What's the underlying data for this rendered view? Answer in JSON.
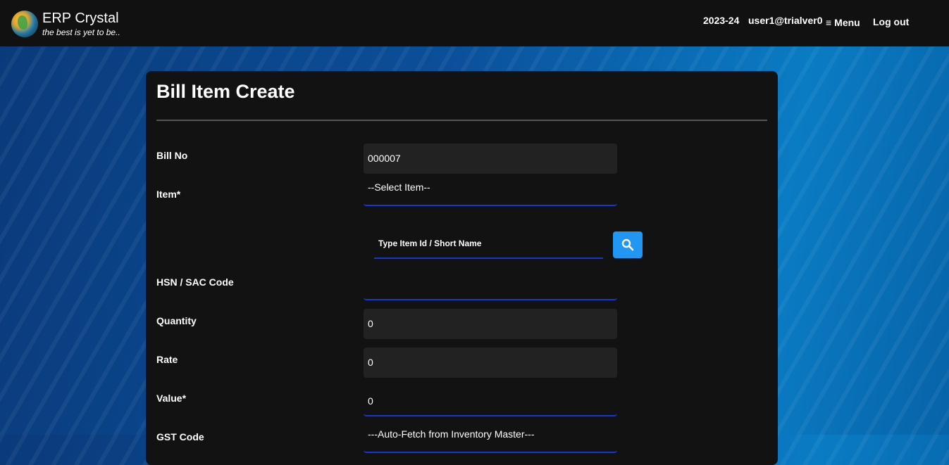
{
  "header": {
    "app_title": "ERP Crystal",
    "tagline": "the best is yet to be..",
    "year": "2023-24",
    "user": "user1@trialver0",
    "menu_label": "Menu",
    "logout_label": "Log out"
  },
  "form": {
    "title": "Bill Item Create",
    "bill_no": {
      "label": "Bill No",
      "value": "000007"
    },
    "item": {
      "label": "Item*",
      "selected": "--Select Item--"
    },
    "item_search": {
      "placeholder": "Type Item Id / Short Name"
    },
    "hsn": {
      "label": "HSN / SAC Code",
      "value": ""
    },
    "quantity": {
      "label": "Quantity",
      "value": "0"
    },
    "rate": {
      "label": "Rate",
      "value": "0"
    },
    "value": {
      "label": "Value*",
      "value": "0"
    },
    "gst_code": {
      "label": "GST Code",
      "selected": "---Auto-Fetch from Inventory Master---"
    }
  },
  "icons": {
    "logo": "globe-icon",
    "menu": "hamburger-icon",
    "search": "search-icon"
  },
  "colors": {
    "accent": "#2196f3",
    "underline": "#1836d6",
    "card": "#121212",
    "topbar": "#111111"
  }
}
